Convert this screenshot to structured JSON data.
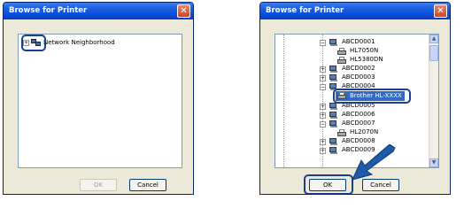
{
  "dialog_left": {
    "title": "Browse for Printer",
    "tree_root_label": "Network Neighborhood",
    "ok_label": "OK",
    "cancel_label": "Cancel",
    "close_icon": "close-icon"
  },
  "dialog_right": {
    "title": "Browse for Printer",
    "tree": [
      {
        "label": "ABCD0001"
      },
      {
        "label": "HL7050N"
      },
      {
        "label": "HL5380DN"
      },
      {
        "label": "ABCD0002"
      },
      {
        "label": "ABCD0003"
      },
      {
        "label": "ABCD0004"
      },
      {
        "label": "Brother HL-XXXX"
      },
      {
        "label": "ABCD0005"
      },
      {
        "label": "ABCD0006"
      },
      {
        "label": "ABCD0007"
      },
      {
        "label": "HL2070N"
      },
      {
        "label": "ABCD0008"
      },
      {
        "label": "ABCD0009"
      }
    ],
    "ok_label": "OK",
    "cancel_label": "Cancel"
  },
  "colors": {
    "callout": "#1b3f8e",
    "titlebar": "#0a4bd8",
    "selected": "#316ac5"
  }
}
